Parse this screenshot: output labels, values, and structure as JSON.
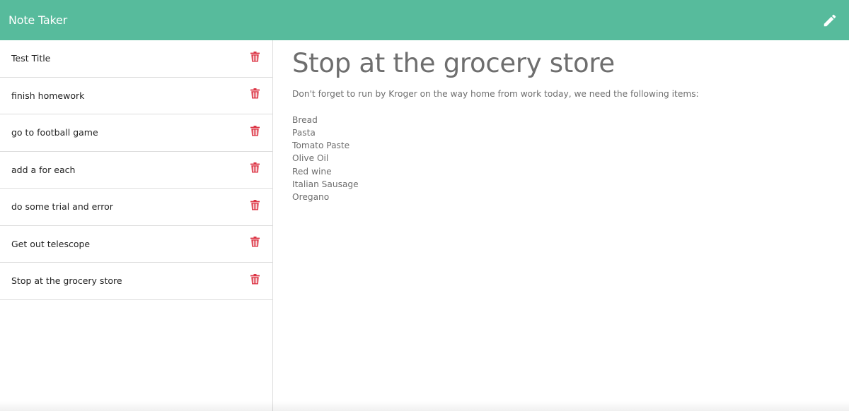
{
  "app": {
    "title": "Note Taker",
    "accent_color": "#57bb9c",
    "delete_icon_color": "#dc3545",
    "new_note_icon": "pencil-icon",
    "delete_icon": "trash-icon"
  },
  "notes": [
    {
      "title": "Test Title"
    },
    {
      "title": "finish homework"
    },
    {
      "title": "go to football game"
    },
    {
      "title": "add a for each"
    },
    {
      "title": "do some trial and error"
    },
    {
      "title": "Get out telescope"
    },
    {
      "title": "Stop at the grocery store"
    }
  ],
  "active_note": {
    "title": "Stop at the grocery store",
    "text": "Don't forget to run by Kroger on the way home from work today, we need the following items:\n\nBread\nPasta\nTomato Paste\nOlive Oil\nRed wine\nItalian Sausage\nOregano"
  }
}
